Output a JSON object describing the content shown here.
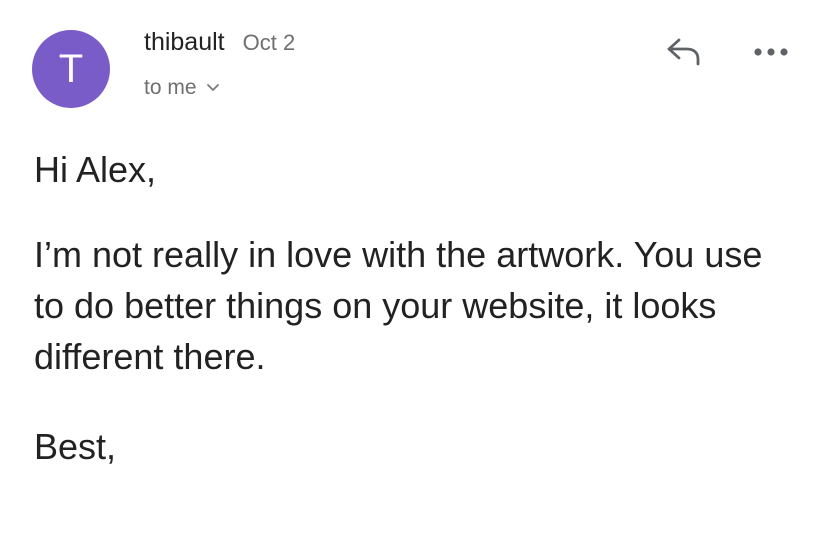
{
  "email": {
    "avatar_letter": "T",
    "avatar_color": "#7a5cc8",
    "sender": "thibault",
    "date": "Oct 2",
    "recipient": "to me",
    "greeting": "Hi Alex,",
    "message": "I’m not really in love with the artwork. You use to do better things on your website, it looks different there.",
    "signoff": "Best,"
  },
  "icons": {
    "recipient_toggle": "chevron-down-icon",
    "reply": "reply-arrow-icon",
    "more": "more-horizontal-icon"
  }
}
